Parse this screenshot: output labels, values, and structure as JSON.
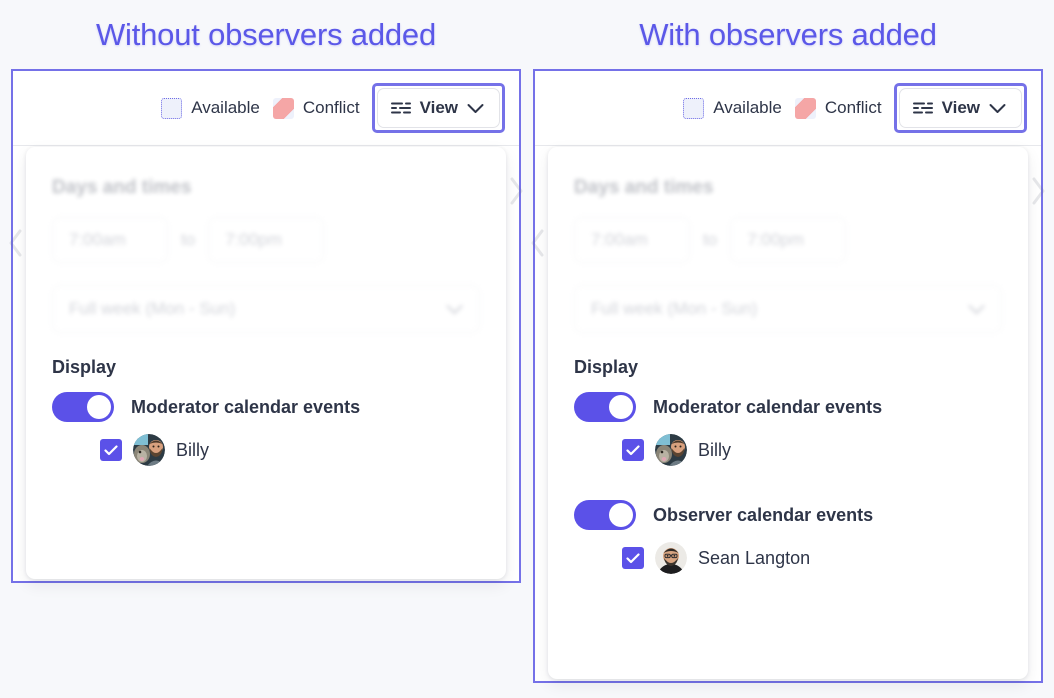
{
  "columns": [
    {
      "title": "Without observers added",
      "legend": [
        {
          "label": "Available",
          "icon": "available-swatch-icon"
        },
        {
          "label": "Conflict",
          "icon": "conflict-swatch-icon"
        }
      ],
      "view_button": {
        "label": "View",
        "icon": "sliders-icon",
        "chevron": "chevron-down-icon",
        "highlighted": true
      },
      "days_and_times": {
        "title": "Days and times",
        "start_time": "7:00am",
        "separator": "to",
        "end_time": "7:00pm",
        "week_select": "Full week (Mon - Sun)"
      },
      "display": {
        "title": "Display",
        "groups": [
          {
            "toggle_label": "Moderator calendar events",
            "toggle_on": true,
            "people": [
              {
                "name": "Billy",
                "checked": true,
                "avatar": "billy-avatar"
              }
            ]
          }
        ]
      }
    },
    {
      "title": "With observers added",
      "legend": [
        {
          "label": "Available",
          "icon": "available-swatch-icon"
        },
        {
          "label": "Conflict",
          "icon": "conflict-swatch-icon"
        }
      ],
      "view_button": {
        "label": "View",
        "icon": "sliders-icon",
        "chevron": "chevron-down-icon",
        "highlighted": true
      },
      "days_and_times": {
        "title": "Days and times",
        "start_time": "7:00am",
        "separator": "to",
        "end_time": "7:00pm",
        "week_select": "Full week (Mon - Sun)"
      },
      "display": {
        "title": "Display",
        "groups": [
          {
            "toggle_label": "Moderator calendar events",
            "toggle_on": true,
            "people": [
              {
                "name": "Billy",
                "checked": true,
                "avatar": "billy-avatar"
              }
            ]
          },
          {
            "toggle_label": "Observer calendar events",
            "toggle_on": true,
            "people": [
              {
                "name": "Sean Langton",
                "checked": true,
                "avatar": "sean-langton-avatar"
              }
            ]
          }
        ]
      }
    }
  ],
  "colors": {
    "accent": "#5b51e8",
    "title": "#5b58e8",
    "highlight_border": "#7571e8",
    "text": "#2e3548",
    "conflict": "#f5a6a6",
    "available_fill": "#eef1fb",
    "page_background": "#f7f8fb"
  }
}
